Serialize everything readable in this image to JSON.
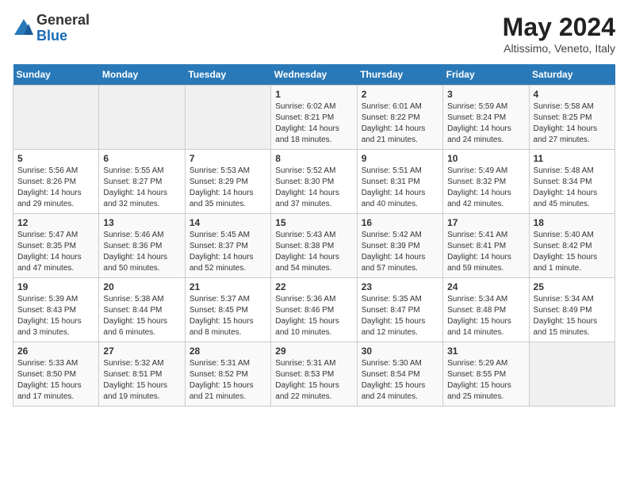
{
  "header": {
    "logo_line1": "General",
    "logo_line2": "Blue",
    "month_title": "May 2024",
    "subtitle": "Altissimo, Veneto, Italy"
  },
  "weekdays": [
    "Sunday",
    "Monday",
    "Tuesday",
    "Wednesday",
    "Thursday",
    "Friday",
    "Saturday"
  ],
  "weeks": [
    [
      {
        "day": "",
        "info": ""
      },
      {
        "day": "",
        "info": ""
      },
      {
        "day": "",
        "info": ""
      },
      {
        "day": "1",
        "info": "Sunrise: 6:02 AM\nSunset: 8:21 PM\nDaylight: 14 hours\nand 18 minutes."
      },
      {
        "day": "2",
        "info": "Sunrise: 6:01 AM\nSunset: 8:22 PM\nDaylight: 14 hours\nand 21 minutes."
      },
      {
        "day": "3",
        "info": "Sunrise: 5:59 AM\nSunset: 8:24 PM\nDaylight: 14 hours\nand 24 minutes."
      },
      {
        "day": "4",
        "info": "Sunrise: 5:58 AM\nSunset: 8:25 PM\nDaylight: 14 hours\nand 27 minutes."
      }
    ],
    [
      {
        "day": "5",
        "info": "Sunrise: 5:56 AM\nSunset: 8:26 PM\nDaylight: 14 hours\nand 29 minutes."
      },
      {
        "day": "6",
        "info": "Sunrise: 5:55 AM\nSunset: 8:27 PM\nDaylight: 14 hours\nand 32 minutes."
      },
      {
        "day": "7",
        "info": "Sunrise: 5:53 AM\nSunset: 8:29 PM\nDaylight: 14 hours\nand 35 minutes."
      },
      {
        "day": "8",
        "info": "Sunrise: 5:52 AM\nSunset: 8:30 PM\nDaylight: 14 hours\nand 37 minutes."
      },
      {
        "day": "9",
        "info": "Sunrise: 5:51 AM\nSunset: 8:31 PM\nDaylight: 14 hours\nand 40 minutes."
      },
      {
        "day": "10",
        "info": "Sunrise: 5:49 AM\nSunset: 8:32 PM\nDaylight: 14 hours\nand 42 minutes."
      },
      {
        "day": "11",
        "info": "Sunrise: 5:48 AM\nSunset: 8:34 PM\nDaylight: 14 hours\nand 45 minutes."
      }
    ],
    [
      {
        "day": "12",
        "info": "Sunrise: 5:47 AM\nSunset: 8:35 PM\nDaylight: 14 hours\nand 47 minutes."
      },
      {
        "day": "13",
        "info": "Sunrise: 5:46 AM\nSunset: 8:36 PM\nDaylight: 14 hours\nand 50 minutes."
      },
      {
        "day": "14",
        "info": "Sunrise: 5:45 AM\nSunset: 8:37 PM\nDaylight: 14 hours\nand 52 minutes."
      },
      {
        "day": "15",
        "info": "Sunrise: 5:43 AM\nSunset: 8:38 PM\nDaylight: 14 hours\nand 54 minutes."
      },
      {
        "day": "16",
        "info": "Sunrise: 5:42 AM\nSunset: 8:39 PM\nDaylight: 14 hours\nand 57 minutes."
      },
      {
        "day": "17",
        "info": "Sunrise: 5:41 AM\nSunset: 8:41 PM\nDaylight: 14 hours\nand 59 minutes."
      },
      {
        "day": "18",
        "info": "Sunrise: 5:40 AM\nSunset: 8:42 PM\nDaylight: 15 hours\nand 1 minute."
      }
    ],
    [
      {
        "day": "19",
        "info": "Sunrise: 5:39 AM\nSunset: 8:43 PM\nDaylight: 15 hours\nand 3 minutes."
      },
      {
        "day": "20",
        "info": "Sunrise: 5:38 AM\nSunset: 8:44 PM\nDaylight: 15 hours\nand 6 minutes."
      },
      {
        "day": "21",
        "info": "Sunrise: 5:37 AM\nSunset: 8:45 PM\nDaylight: 15 hours\nand 8 minutes."
      },
      {
        "day": "22",
        "info": "Sunrise: 5:36 AM\nSunset: 8:46 PM\nDaylight: 15 hours\nand 10 minutes."
      },
      {
        "day": "23",
        "info": "Sunrise: 5:35 AM\nSunset: 8:47 PM\nDaylight: 15 hours\nand 12 minutes."
      },
      {
        "day": "24",
        "info": "Sunrise: 5:34 AM\nSunset: 8:48 PM\nDaylight: 15 hours\nand 14 minutes."
      },
      {
        "day": "25",
        "info": "Sunrise: 5:34 AM\nSunset: 8:49 PM\nDaylight: 15 hours\nand 15 minutes."
      }
    ],
    [
      {
        "day": "26",
        "info": "Sunrise: 5:33 AM\nSunset: 8:50 PM\nDaylight: 15 hours\nand 17 minutes."
      },
      {
        "day": "27",
        "info": "Sunrise: 5:32 AM\nSunset: 8:51 PM\nDaylight: 15 hours\nand 19 minutes."
      },
      {
        "day": "28",
        "info": "Sunrise: 5:31 AM\nSunset: 8:52 PM\nDaylight: 15 hours\nand 21 minutes."
      },
      {
        "day": "29",
        "info": "Sunrise: 5:31 AM\nSunset: 8:53 PM\nDaylight: 15 hours\nand 22 minutes."
      },
      {
        "day": "30",
        "info": "Sunrise: 5:30 AM\nSunset: 8:54 PM\nDaylight: 15 hours\nand 24 minutes."
      },
      {
        "day": "31",
        "info": "Sunrise: 5:29 AM\nSunset: 8:55 PM\nDaylight: 15 hours\nand 25 minutes."
      },
      {
        "day": "",
        "info": ""
      }
    ]
  ]
}
